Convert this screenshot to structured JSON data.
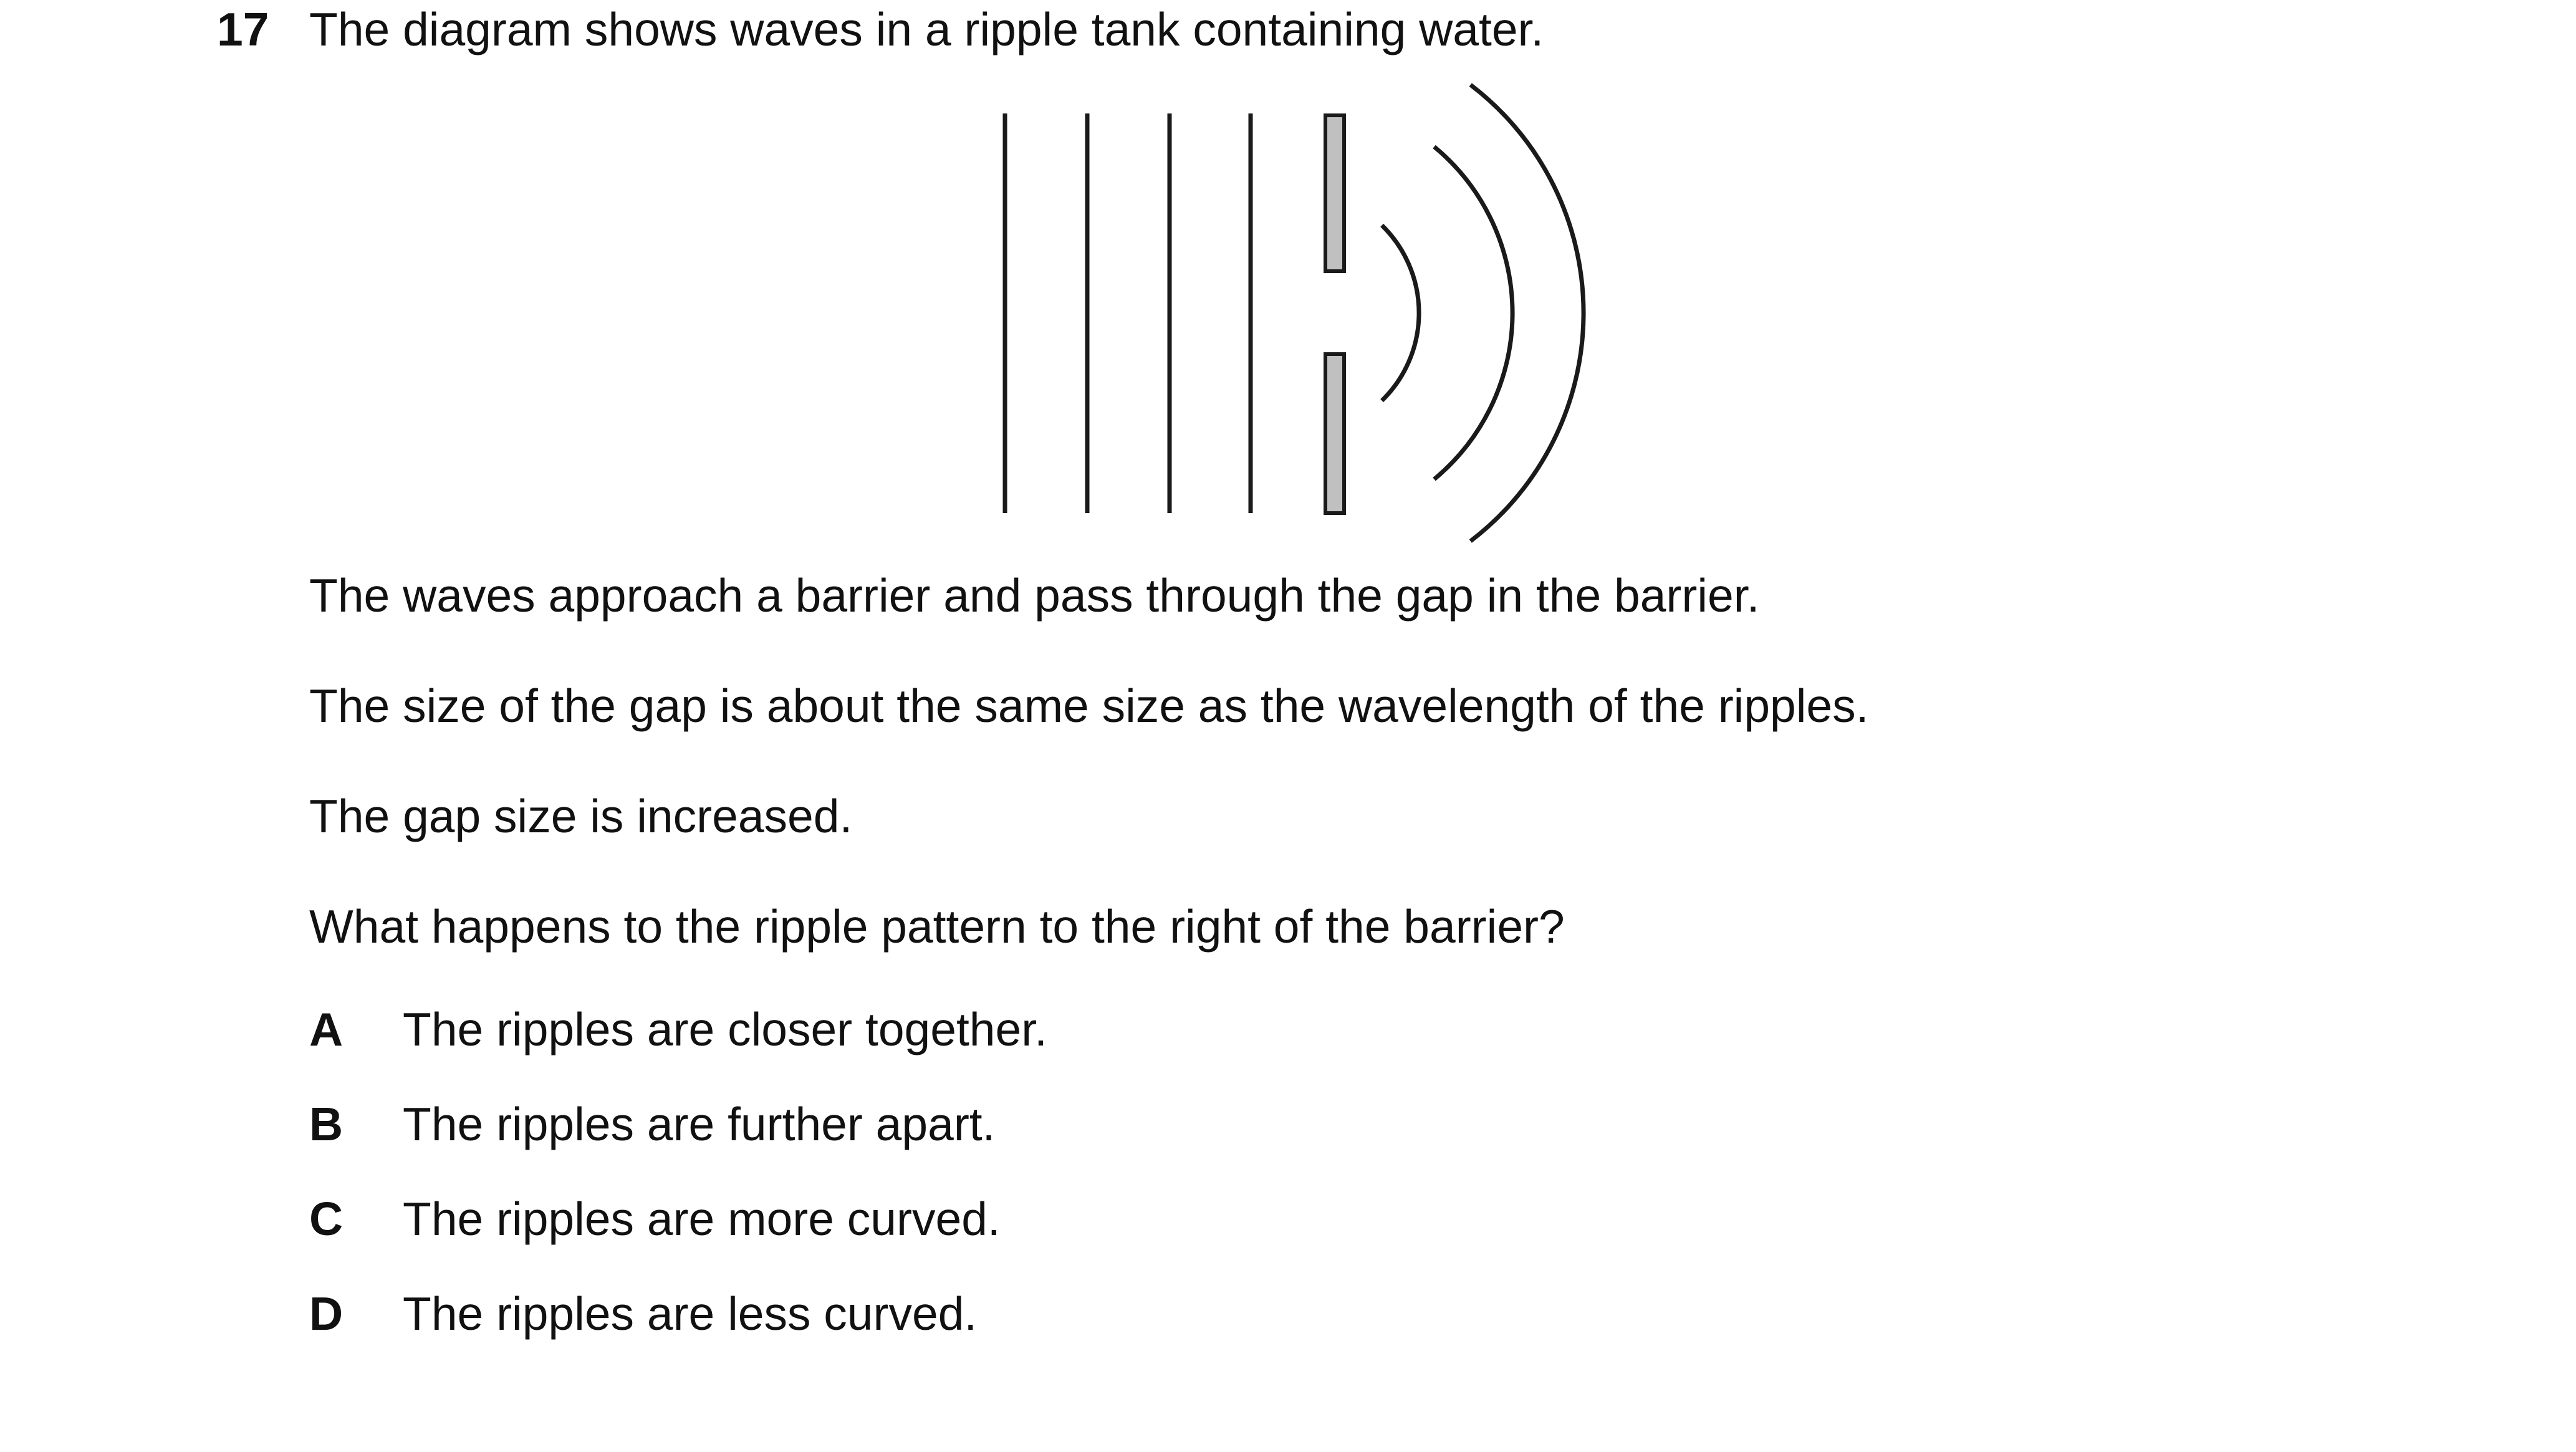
{
  "question": {
    "number": "17",
    "stem": "The diagram shows waves in a ripple tank containing water."
  },
  "diagram": {
    "incident_wavefront_count": 4,
    "diffracted_wavefront_count": 3,
    "barrier_color": "#c0c0c0",
    "line_color": "#1a1a1a"
  },
  "body": {
    "p1": "The waves approach a barrier and pass through the gap in the barrier.",
    "p2": "The size of the gap is about the same size as the wavelength of the ripples.",
    "p3": "The gap size is increased.",
    "p4": "What happens to the ripple pattern to the right of the barrier?"
  },
  "options": [
    {
      "letter": "A",
      "text": "The ripples are closer together."
    },
    {
      "letter": "B",
      "text": "The ripples are further apart."
    },
    {
      "letter": "C",
      "text": "The ripples are more curved."
    },
    {
      "letter": "D",
      "text": "The ripples are less curved."
    }
  ]
}
